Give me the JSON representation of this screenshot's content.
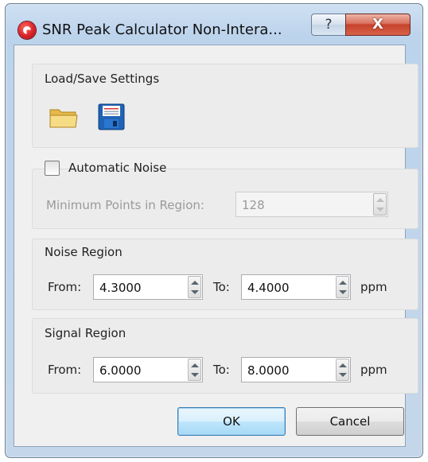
{
  "window": {
    "title": "SNR Peak Calculator Non-Intera...",
    "help_label": "?",
    "close_label": "X"
  },
  "load_save": {
    "group_title": "Load/Save Settings",
    "open_icon": "folder-open-icon",
    "save_icon": "floppy-disk-icon"
  },
  "automatic_noise": {
    "checkbox_label": "Automatic Noise",
    "checked": false,
    "min_points_label": "Minimum Points in Region:",
    "min_points_value": "128"
  },
  "noise_region": {
    "group_title": "Noise Region",
    "from_label": "From:",
    "from_value": "4.3000",
    "to_label": "To:",
    "to_value": "4.4000",
    "unit": "ppm"
  },
  "signal_region": {
    "group_title": "Signal Region",
    "from_label": "From:",
    "from_value": "6.0000",
    "to_label": "To:",
    "to_value": "8.0000",
    "unit": "ppm"
  },
  "buttons": {
    "ok_label": "OK",
    "cancel_label": "Cancel"
  },
  "colors": {
    "accent_close": "#c7412a",
    "default_button_border": "#3c7fb1"
  }
}
